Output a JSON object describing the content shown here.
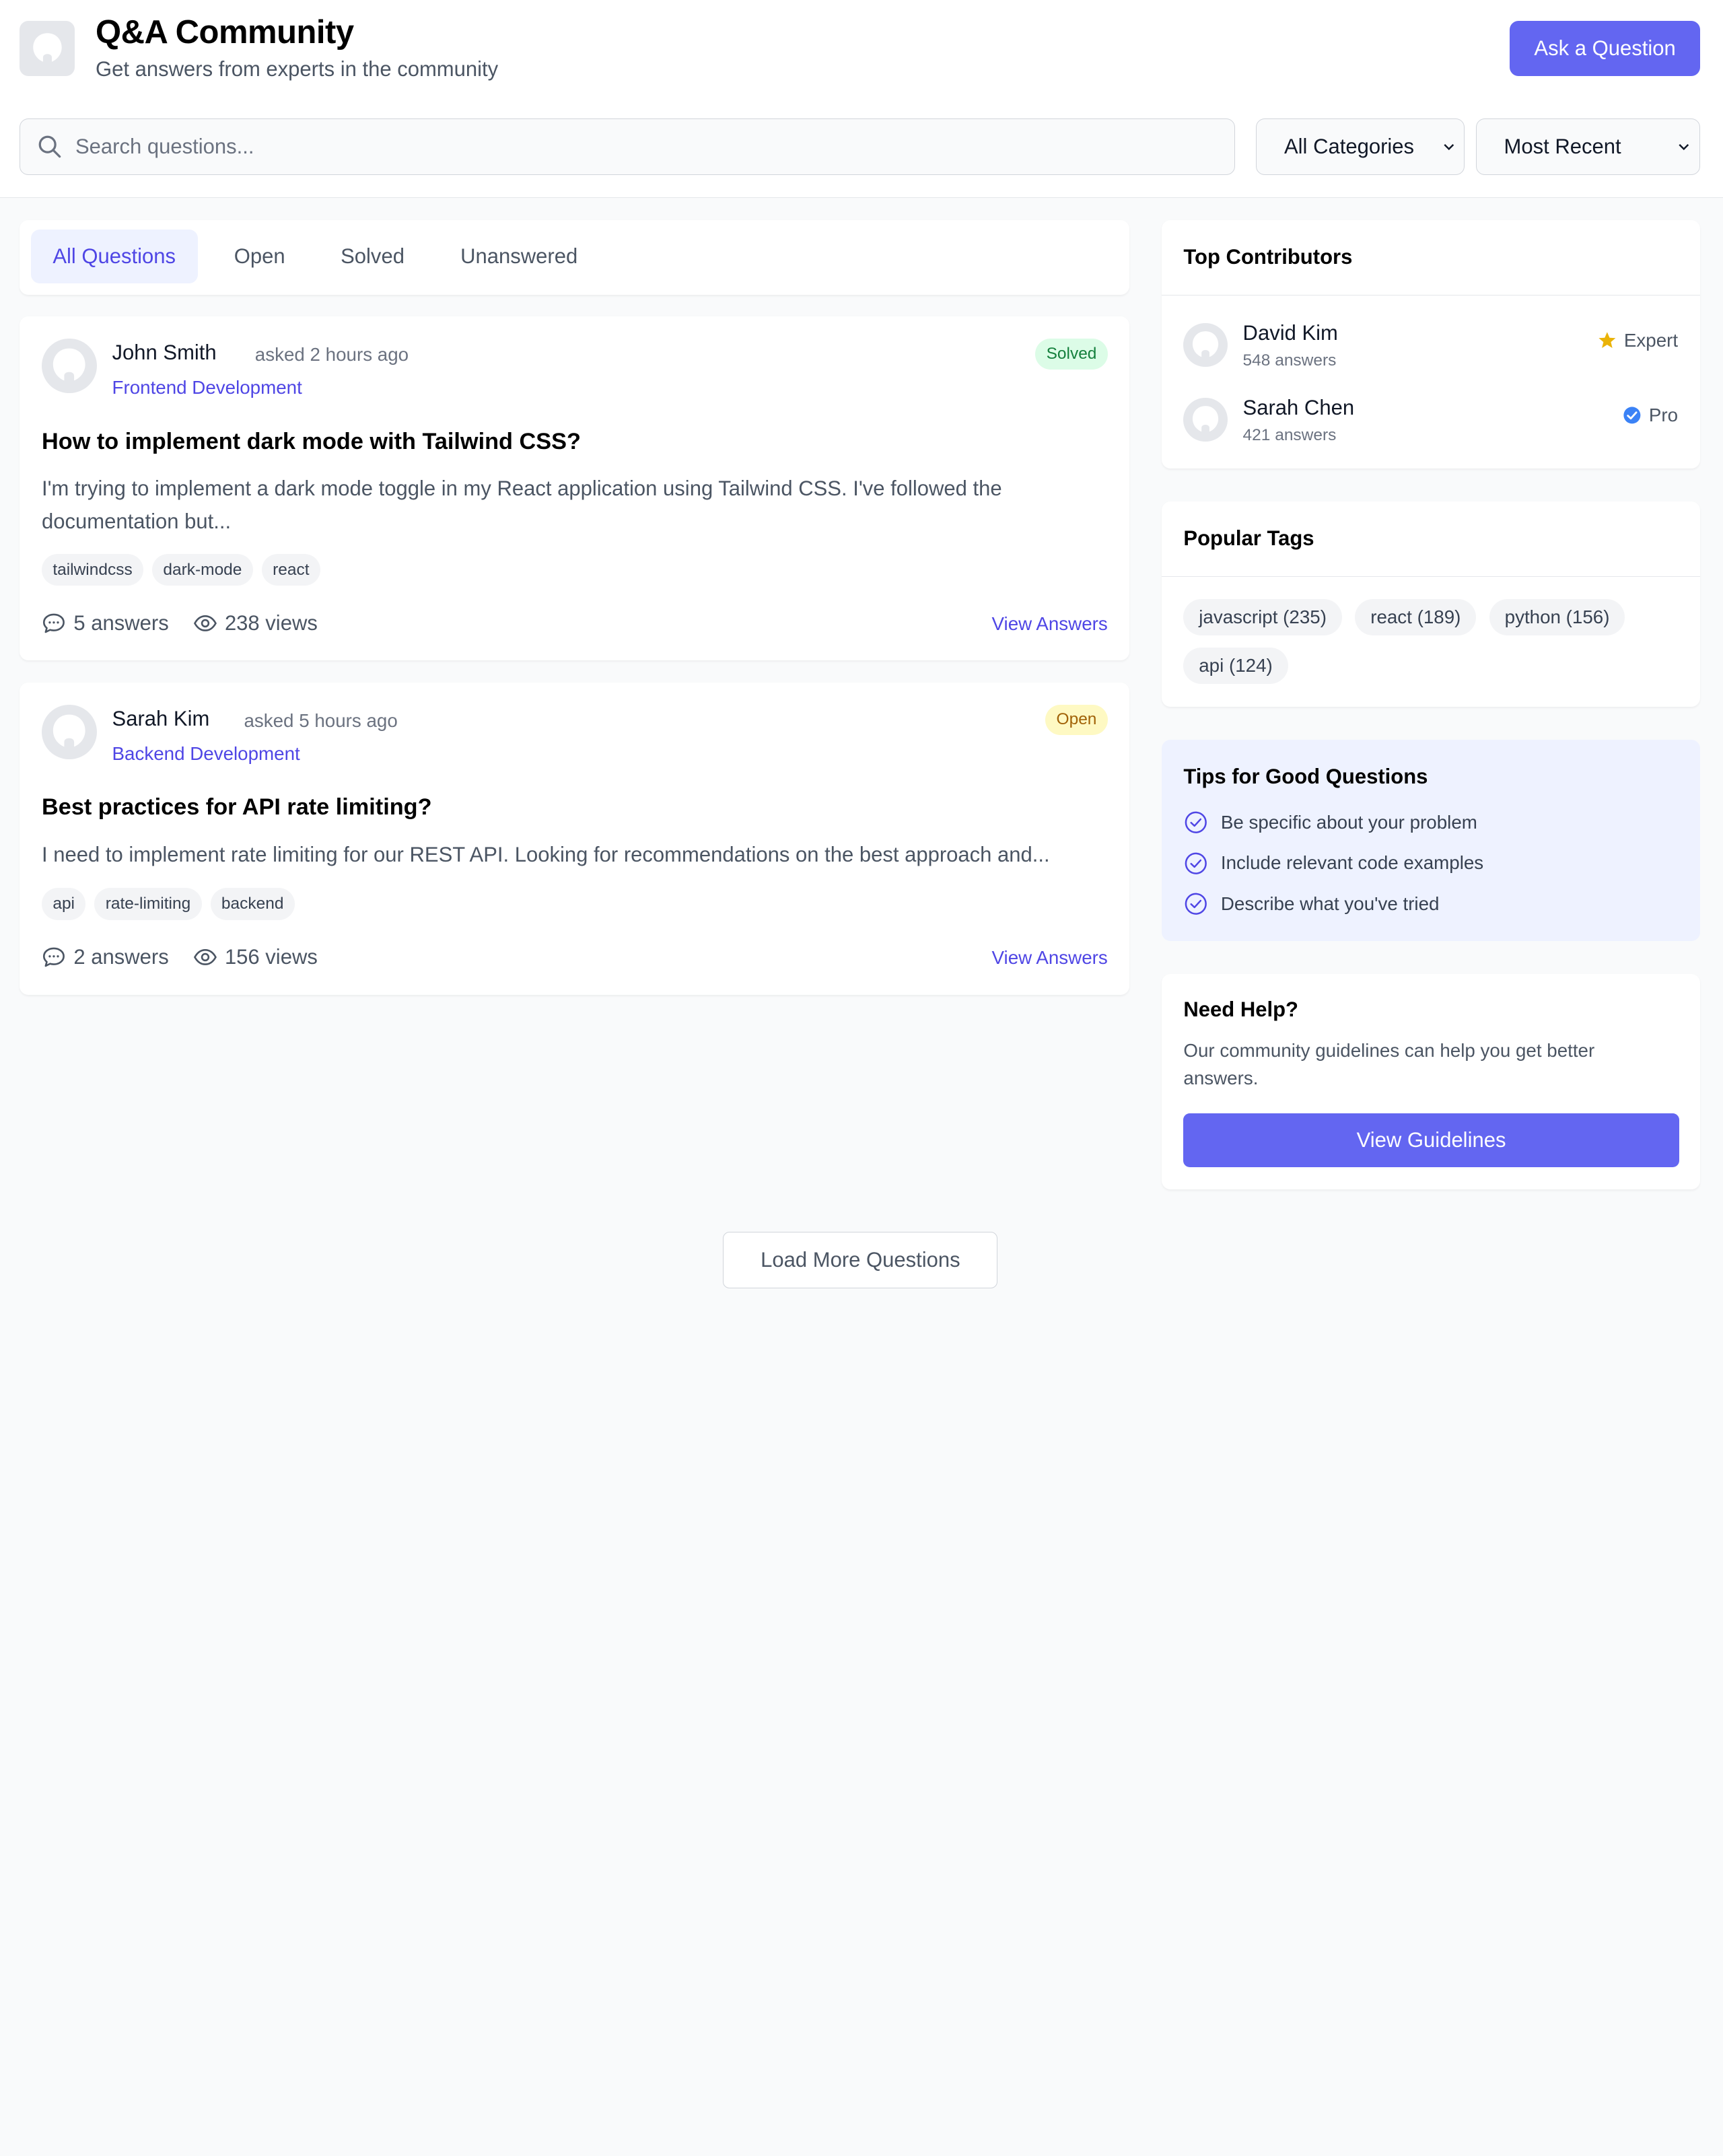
{
  "header": {
    "title": "Q&A Community",
    "subtitle": "Get answers from experts in the community",
    "ask_button": "Ask a Question",
    "logo_icon": "user-avatar-icon"
  },
  "search": {
    "placeholder": "Search questions..."
  },
  "filters": {
    "category": {
      "selected": "All Categories"
    },
    "sort": {
      "selected": "Most Recent"
    }
  },
  "tabs": [
    {
      "label": "All Questions",
      "active": true
    },
    {
      "label": "Open",
      "active": false
    },
    {
      "label": "Solved",
      "active": false
    },
    {
      "label": "Unanswered",
      "active": false
    }
  ],
  "questions": [
    {
      "author": "John Smith",
      "asked": "asked 2 hours ago",
      "category": "Frontend Development",
      "status": "Solved",
      "title": "How to implement dark mode with Tailwind CSS?",
      "excerpt": "I'm trying to implement a dark mode toggle in my React application using Tailwind CSS. I've followed the documentation but...",
      "tags": [
        "tailwindcss",
        "dark-mode",
        "react"
      ],
      "answers": "5 answers",
      "views": "238 views",
      "link": "View Answers"
    },
    {
      "author": "Sarah Kim",
      "asked": "asked 5 hours ago",
      "category": "Backend Development",
      "status": "Open",
      "title": "Best practices for API rate limiting?",
      "excerpt": "I need to implement rate limiting for our REST API. Looking for recommendations on the best approach and...",
      "tags": [
        "api",
        "rate-limiting",
        "backend"
      ],
      "answers": "2 answers",
      "views": "156 views",
      "link": "View Answers"
    }
  ],
  "sidebar": {
    "contributors": {
      "title": "Top Contributors",
      "items": [
        {
          "name": "David Kim",
          "answers": "548 answers",
          "rank": "Expert",
          "rank_icon": "star-icon",
          "rank_color": "#eab308"
        },
        {
          "name": "Sarah Chen",
          "answers": "421 answers",
          "rank": "Pro",
          "rank_icon": "verified-check-icon",
          "rank_color": "#3b82f6"
        }
      ]
    },
    "popular_tags": {
      "title": "Popular Tags",
      "items": [
        "javascript (235)",
        "react (189)",
        "python (156)",
        "api (124)"
      ]
    },
    "tips": {
      "title": "Tips for Good Questions",
      "items": [
        "Be specific about your problem",
        "Include relevant code examples",
        "Describe what you've tried"
      ]
    },
    "help": {
      "title": "Need Help?",
      "text": "Our community guidelines can help you get better answers.",
      "button": "View Guidelines"
    }
  },
  "load_more": "Load More Questions",
  "colors": {
    "accent": "#6366f1",
    "accent_text": "#4f46e5",
    "solved_bg": "#dcfce7",
    "solved_text": "#15803d",
    "open_bg": "#fef9c3",
    "open_text": "#a16207"
  }
}
